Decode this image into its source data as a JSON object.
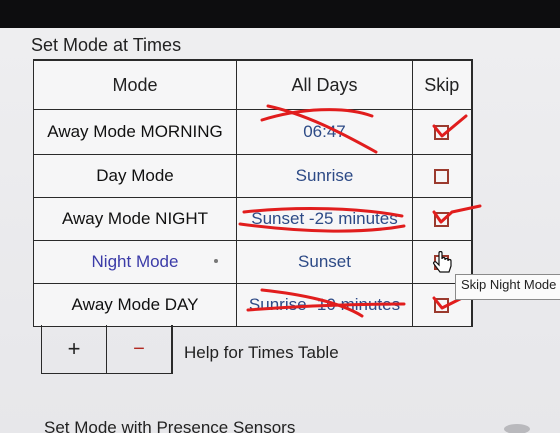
{
  "section_title": "Set Mode at Times",
  "table": {
    "headers": {
      "mode": "Mode",
      "days": "All Days",
      "skip": "Skip"
    },
    "rows": [
      {
        "mode": "Away Mode MORNING",
        "time": "06:47",
        "struck": true,
        "skip": true,
        "link": false
      },
      {
        "mode": "Day Mode",
        "time": "Sunrise",
        "struck": false,
        "skip": false,
        "link": false
      },
      {
        "mode": "Away Mode NIGHT",
        "time": "Sunset -25 minutes",
        "struck": true,
        "skip": true,
        "link": false
      },
      {
        "mode": "Night Mode",
        "time": "Sunset",
        "struck": false,
        "skip": false,
        "link": true
      },
      {
        "mode": "Away Mode DAY",
        "time": "Sunrise -10 minutes",
        "struck": true,
        "skip": true,
        "link": false
      }
    ]
  },
  "toolbar": {
    "add_label": "+",
    "remove_label": "−"
  },
  "help_link": "Help for Times Table",
  "tooltip": "Skip Night Mode",
  "next_section": "Set Mode with Presence Sensors",
  "colors": {
    "mark": "#e11d1d",
    "link": "#3b3ba8",
    "time_text": "#2d4a86"
  },
  "icons": {
    "cursor": "hand-pointer-icon",
    "checkbox": "checkbox-icon"
  }
}
